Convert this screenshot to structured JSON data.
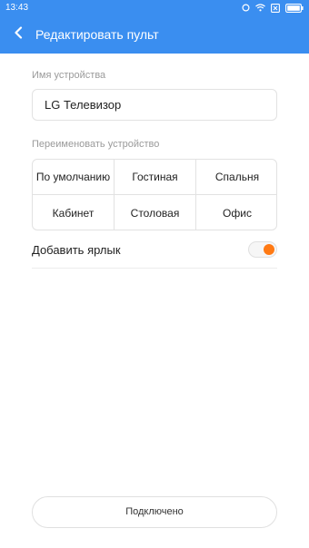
{
  "status_bar": {
    "time": "13:43",
    "icons": [
      "circle-icon",
      "wifi-icon",
      "sim-icon",
      "battery-icon"
    ]
  },
  "app_bar": {
    "back_icon": "chevron-left-icon",
    "title": "Редактировать пульт"
  },
  "device_name": {
    "label": "Имя устройства",
    "value": "LG Телевизор"
  },
  "rename": {
    "label": "Переименовать устройство",
    "options": [
      "По умолчанию",
      "Гостиная",
      "Спальня",
      "Кабинет",
      "Столовая",
      "Офис"
    ]
  },
  "shortcut": {
    "label": "Добавить ярлык",
    "enabled": true
  },
  "footer": {
    "connected_label": "Подключено"
  },
  "colors": {
    "primary": "#3a8ef0",
    "toggle_on": "#ff7a14"
  }
}
